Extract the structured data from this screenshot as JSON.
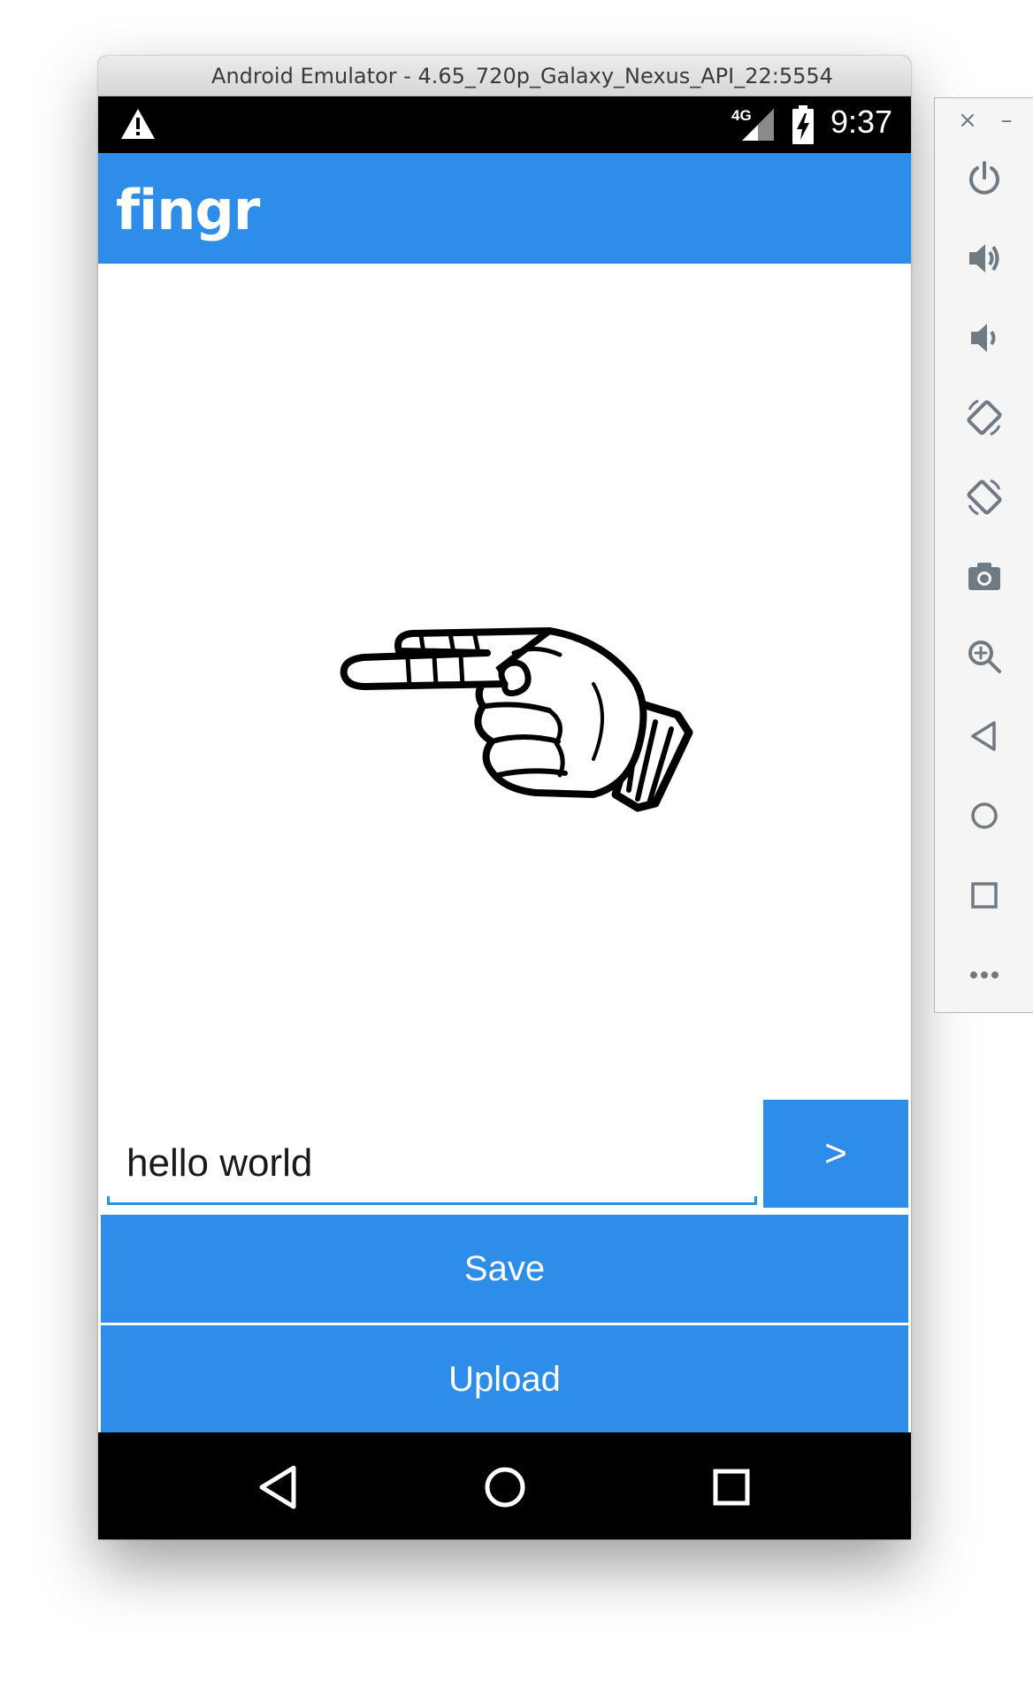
{
  "window": {
    "title": "Android Emulator - 4.65_720p_Galaxy_Nexus_API_22:5554"
  },
  "status_bar": {
    "network_label": "4G",
    "time": "9:37",
    "icons": [
      "warning-icon",
      "signal-icon",
      "battery-charging-icon"
    ]
  },
  "app": {
    "title": "fingr"
  },
  "main": {
    "image": "asl-hand-sign",
    "input_value": "hello world",
    "send_label": ">",
    "save_label": "Save",
    "upload_label": "Upload"
  },
  "nav_bar": {
    "icons": [
      "back-icon",
      "home-icon",
      "recents-icon"
    ]
  },
  "side_panel": {
    "close_symbol": "×",
    "minimize_symbol": "–",
    "tools": [
      "power-icon",
      "volume-up-icon",
      "volume-down-icon",
      "rotate-left-icon",
      "rotate-right-icon",
      "camera-icon",
      "zoom-icon",
      "back-icon",
      "home-icon",
      "overview-icon",
      "more-icon"
    ]
  },
  "colors": {
    "accent": "#2f8dea",
    "input_underline": "#2196d8",
    "status_bar": "#000000",
    "panel_icons": "#6f7a82"
  }
}
